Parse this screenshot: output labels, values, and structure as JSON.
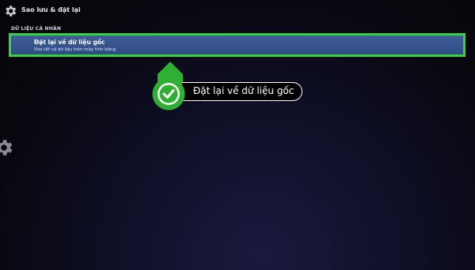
{
  "header": {
    "title": "Sao lưu & đặt lại",
    "icon": "gear-icon"
  },
  "section": {
    "header": "DỮ LIỆU CÁ NHÂN"
  },
  "item": {
    "title": "Đặt lại về dữ liệu gốc",
    "subtitle": "Xóa tất cả dữ liệu trên máy tính bảng"
  },
  "callout": {
    "label": "Đặt lại về dữ liệu gốc",
    "icon": "checkmark-icon"
  },
  "colors": {
    "highlight_border": "#37d23c",
    "item_background": "#3a5894",
    "callout_green": "#2fb034"
  }
}
